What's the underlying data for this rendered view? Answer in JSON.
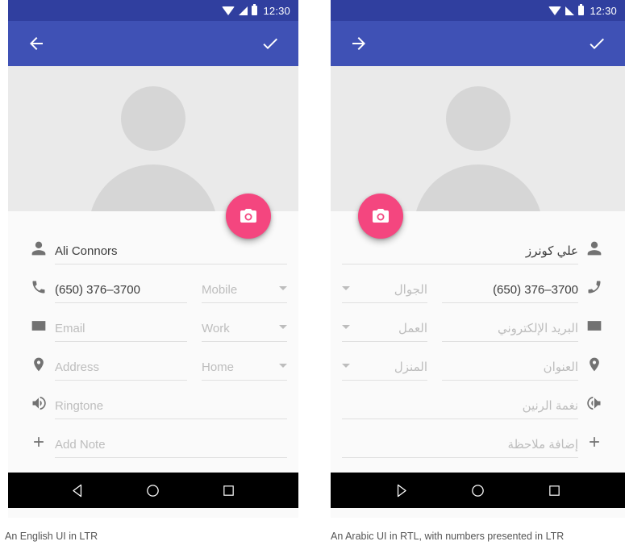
{
  "panels": {
    "ltr": {
      "direction": "ltr",
      "statusbar": {
        "time": "12:30",
        "icons": [
          "wifi-icon",
          "signal-icon",
          "battery-icon"
        ]
      },
      "appbar": {
        "leading_icon": "back-arrow-icon",
        "trailing_icon": "check-icon"
      },
      "fab": {
        "icon": "camera-icon",
        "color": "#f4467f"
      },
      "rows": [
        {
          "icon": "person-icon",
          "value": "Ali Connors",
          "is_placeholder": false,
          "type_label": null
        },
        {
          "icon": "phone-icon",
          "value": "(650) 376–3700",
          "is_placeholder": false,
          "type_label": "Mobile"
        },
        {
          "icon": "email-icon",
          "value": "Email",
          "is_placeholder": true,
          "type_label": "Work"
        },
        {
          "icon": "location-pin-icon",
          "value": "Address",
          "is_placeholder": true,
          "type_label": "Home"
        },
        {
          "icon": "volume-icon",
          "value": "Ringtone",
          "is_placeholder": true,
          "type_label": null
        },
        {
          "icon": "plus-icon",
          "value": "Add Note",
          "is_placeholder": true,
          "type_label": null
        }
      ],
      "navbar": [
        "back-triangle-icon",
        "home-circle-icon",
        "recents-square-icon"
      ],
      "caption": "An English UI in LTR"
    },
    "rtl": {
      "direction": "rtl",
      "statusbar": {
        "time": "12:30",
        "icons": [
          "battery-icon",
          "signal-icon",
          "wifi-icon"
        ]
      },
      "appbar": {
        "leading_icon": "check-icon",
        "trailing_icon": "forward-arrow-icon"
      },
      "fab": {
        "icon": "camera-icon",
        "color": "#f4467f"
      },
      "rows": [
        {
          "icon": "person-icon",
          "value": "علي كونرز",
          "is_placeholder": false,
          "type_label": null
        },
        {
          "icon": "phone-icon",
          "value": "(650) 376–3700",
          "is_placeholder": false,
          "type_label": "الجوال"
        },
        {
          "icon": "email-icon",
          "value": "البريد الإلكتروني",
          "is_placeholder": true,
          "type_label": "العمل"
        },
        {
          "icon": "location-pin-icon",
          "value": "العنوان",
          "is_placeholder": true,
          "type_label": "المنزل"
        },
        {
          "icon": "volume-icon",
          "value": "نغمة الرنين",
          "is_placeholder": true,
          "type_label": null
        },
        {
          "icon": "plus-icon",
          "value": "إضافة ملاحظة",
          "is_placeholder": true,
          "type_label": null
        }
      ],
      "navbar": [
        "recents-square-icon",
        "home-circle-icon",
        "back-triangle-icon"
      ],
      "caption": "An Arabic UI in RTL, with numbers presented in LTR"
    }
  },
  "colors": {
    "status_bar": "#303f9f",
    "app_bar": "#3f51b5",
    "fab": "#f4467f",
    "nav_bar": "#000000",
    "hero": "#eaeaea",
    "avatar": "#d6d6d6",
    "surface": "#fafafa"
  }
}
